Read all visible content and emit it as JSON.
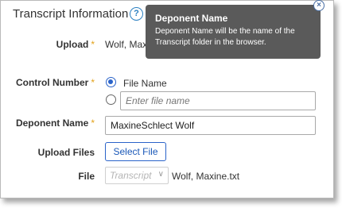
{
  "panel": {
    "title": "Transcript Information",
    "help_icon": "?"
  },
  "upload": {
    "label": "Upload",
    "required_mark": "*",
    "value": "Wolf, Maxine.txt"
  },
  "control_number": {
    "label": "Control Number",
    "required_mark": "*",
    "option_file_name": "File Name",
    "option_file_name_selected": true,
    "placeholder": "Enter file name"
  },
  "deponent_name": {
    "label": "Deponent Name",
    "required_mark": "*",
    "value": "MaxineSchlect Wolf"
  },
  "upload_files": {
    "label": "Upload Files",
    "button": "Select File"
  },
  "file": {
    "label": "File",
    "select_value": "Transcript",
    "file_name": "Wolf, Maxine.txt"
  },
  "tooltip": {
    "title": "Deponent Name",
    "body": "Deponent Name will be the name of the Transcript folder in the browser.",
    "close_icon": "×"
  },
  "colors": {
    "accent": "#2a63c9",
    "required": "#e3a21a",
    "tooltip_bg": "#5a5a5a"
  }
}
